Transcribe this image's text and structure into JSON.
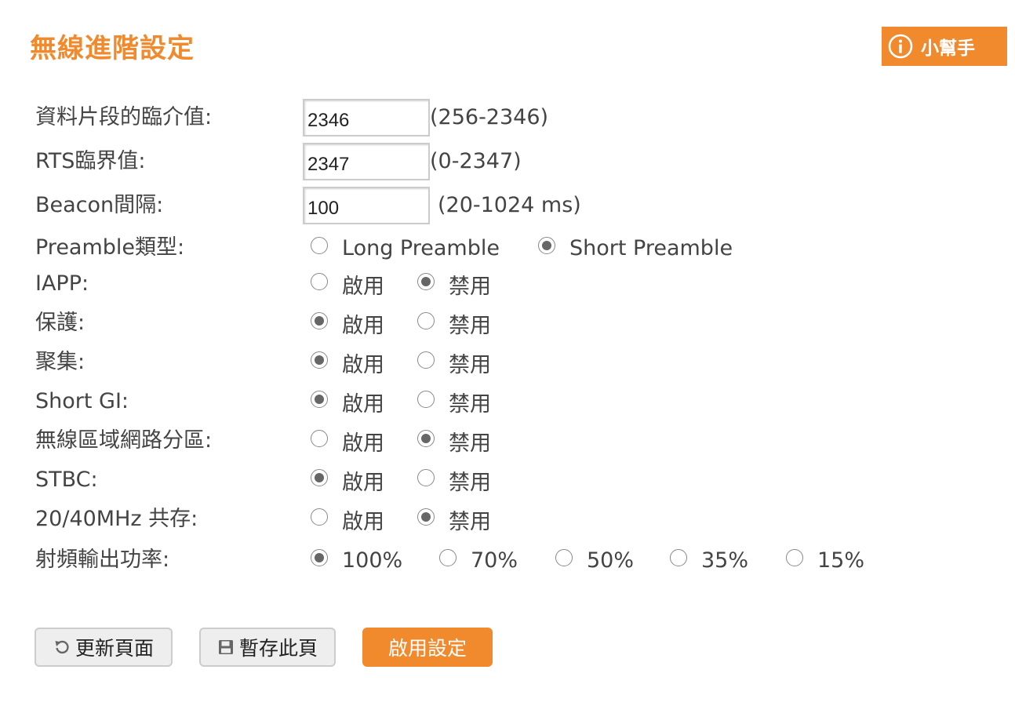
{
  "page": {
    "title": "無線進階設定"
  },
  "help": {
    "label": "小幫手",
    "icon": "info-icon"
  },
  "colors": {
    "accent": "#f08a2c",
    "text": "#444444"
  },
  "text_fields": [
    {
      "label": "資料片段的臨介值:",
      "value": "2346",
      "hint": "(256-2346)"
    },
    {
      "label": "RTS臨界值:",
      "value": "2347",
      "hint": "(0-2347)"
    },
    {
      "label": "Beacon間隔:",
      "value": "100",
      "hint": "(20-1024 ms)"
    }
  ],
  "radio_groups": [
    {
      "label": "Preamble類型:",
      "options": [
        "Long Preamble",
        "Short Preamble"
      ],
      "selected": "Short Preamble"
    },
    {
      "label": "IAPP:",
      "options": [
        "啟用",
        "禁用"
      ],
      "selected": "禁用"
    },
    {
      "label": "保護:",
      "options": [
        "啟用",
        "禁用"
      ],
      "selected": "啟用"
    },
    {
      "label": "聚集:",
      "options": [
        "啟用",
        "禁用"
      ],
      "selected": "啟用"
    },
    {
      "label": "Short GI:",
      "options": [
        "啟用",
        "禁用"
      ],
      "selected": "啟用"
    },
    {
      "label": "無線區域網路分區:",
      "options": [
        "啟用",
        "禁用"
      ],
      "selected": "禁用"
    },
    {
      "label": "STBC:",
      "options": [
        "啟用",
        "禁用"
      ],
      "selected": "啟用"
    },
    {
      "label": "20/40MHz 共存:",
      "options": [
        "啟用",
        "禁用"
      ],
      "selected": "禁用"
    },
    {
      "label": "射頻輸出功率:",
      "options": [
        "100%",
        "70%",
        "50%",
        "35%",
        "15%"
      ],
      "selected": "100%"
    }
  ],
  "buttons": {
    "refresh": {
      "label": "更新頁面",
      "icon": "refresh-icon"
    },
    "save": {
      "label": "暫存此頁",
      "icon": "floppy-disk-icon"
    },
    "apply": {
      "label": "啟用設定"
    }
  }
}
